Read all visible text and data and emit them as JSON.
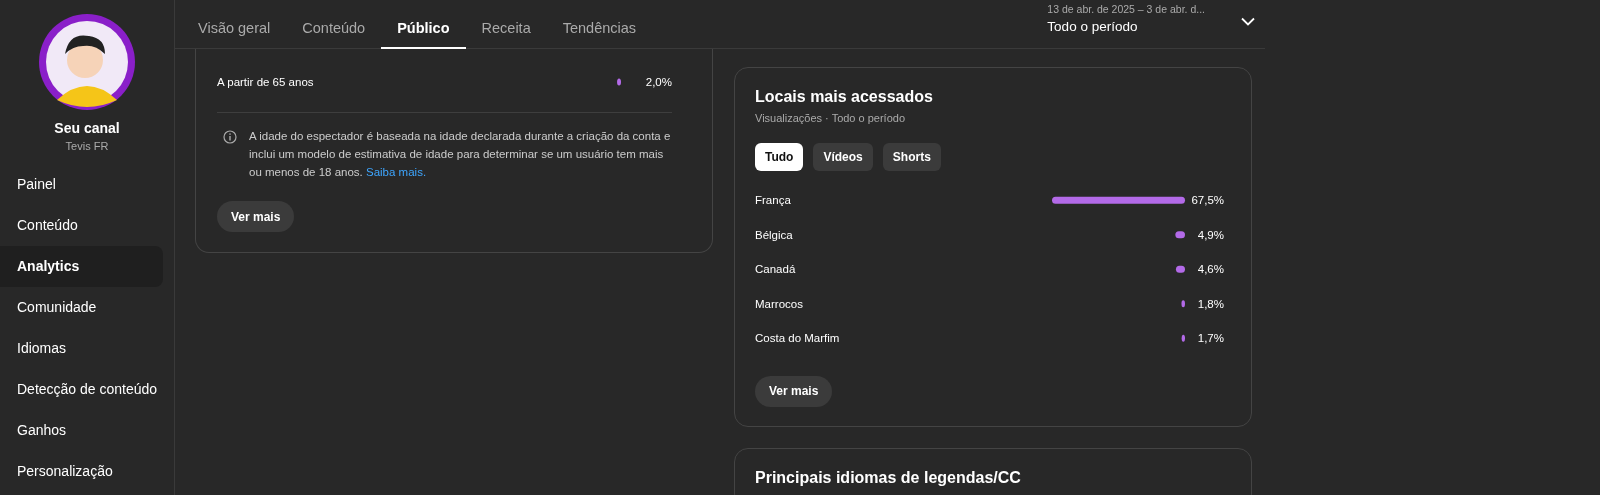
{
  "sidebar": {
    "channel_title": "Seu canal",
    "channel_name": "Tevis FR",
    "items": [
      {
        "label": "Painel",
        "selected": false
      },
      {
        "label": "Conteúdo",
        "selected": false
      },
      {
        "label": "Analytics",
        "selected": true
      },
      {
        "label": "Comunidade",
        "selected": false
      },
      {
        "label": "Idiomas",
        "selected": false
      },
      {
        "label": "Detecção de conteúdo",
        "selected": false
      },
      {
        "label": "Ganhos",
        "selected": false
      },
      {
        "label": "Personalização",
        "selected": false
      }
    ]
  },
  "tabs": [
    {
      "label": "Visão geral",
      "selected": false
    },
    {
      "label": "Conteúdo",
      "selected": false
    },
    {
      "label": "Público",
      "selected": true
    },
    {
      "label": "Receita",
      "selected": false
    },
    {
      "label": "Tendências",
      "selected": false
    }
  ],
  "period": {
    "range": "13 de abr. de 2025 – 3 de abr. d...",
    "label": "Todo o período"
  },
  "age_card": {
    "chart_data": {
      "type": "bar",
      "orientation": "horizontal",
      "categories": [
        "A partir de 65 anos"
      ],
      "values": [
        2.0
      ],
      "value_labels": [
        "2,0%"
      ]
    },
    "note": "A idade do espectador é baseada na idade declarada durante a criação da conta e inclui um modelo de estimativa de idade para determinar se um usuário tem mais ou menos de 18 anos.",
    "link": "Saiba mais.",
    "button": "Ver mais"
  },
  "locations_card": {
    "title": "Locais mais acessados",
    "subtitle": "Visualizações · Todo o período",
    "chips": [
      {
        "label": "Tudo",
        "selected": true
      },
      {
        "label": "Vídeos",
        "selected": false
      },
      {
        "label": "Shorts",
        "selected": false
      }
    ],
    "chart_data": {
      "type": "bar",
      "orientation": "horizontal",
      "categories": [
        "França",
        "Bélgica",
        "Canadá",
        "Marrocos",
        "Costa do Marfim"
      ],
      "values": [
        67.5,
        4.9,
        4.6,
        1.8,
        1.7
      ],
      "value_labels": [
        "67,5%",
        "4,9%",
        "4,6%",
        "1,8%",
        "1,7%"
      ]
    },
    "button": "Ver mais"
  },
  "languages_card": {
    "title": "Principais idiomas de legendas/CC"
  }
}
